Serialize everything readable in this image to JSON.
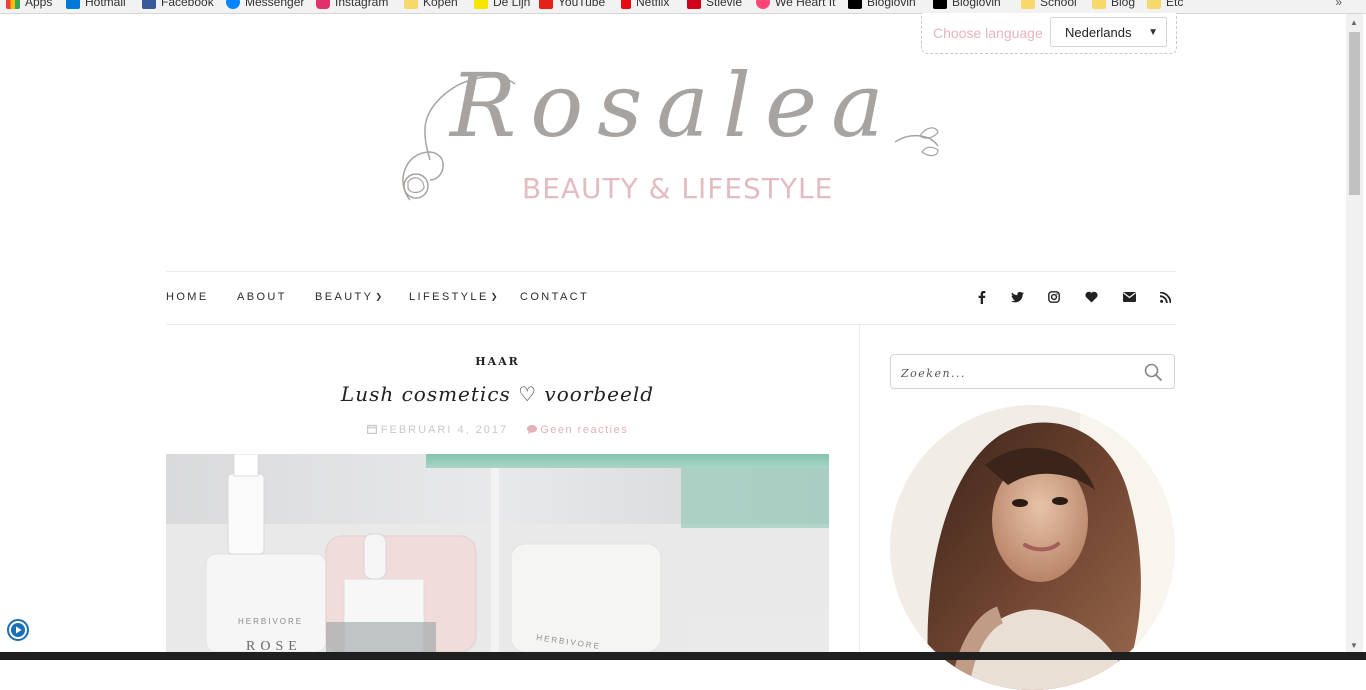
{
  "bookmarks": {
    "items": [
      {
        "label": "Apps",
        "icon": "apps-grid-icon",
        "color": "#4285f4"
      },
      {
        "label": "Hotmail",
        "icon": "hotmail-icon",
        "color": "#0078d7"
      },
      {
        "label": "Facebook",
        "icon": "facebook-icon",
        "color": "#3b5998"
      },
      {
        "label": "Messenger",
        "icon": "messenger-icon",
        "color": "#0084ff"
      },
      {
        "label": "Instagram",
        "icon": "instagram-icon",
        "color": "#e1306c"
      },
      {
        "label": "Kopen",
        "icon": "folder-icon",
        "color": "#f6d86b"
      },
      {
        "label": "De Lijn",
        "icon": "delijn-icon",
        "color": "#f7e600"
      },
      {
        "label": "YouTube",
        "icon": "youtube-icon",
        "color": "#e62117"
      },
      {
        "label": "Netflix",
        "icon": "netflix-icon",
        "color": "#e50914"
      },
      {
        "label": "Stievie",
        "icon": "stievie-icon",
        "color": "#d0021b"
      },
      {
        "label": "We Heart It",
        "icon": "weheartit-icon",
        "color": "#ff4477"
      },
      {
        "label": "Bloglovin",
        "icon": "bloglovin-icon",
        "color": "#000000"
      },
      {
        "label": "Bloglovin",
        "icon": "bloglovin-icon",
        "color": "#000000"
      },
      {
        "label": "School",
        "icon": "folder-icon",
        "color": "#f6d86b"
      },
      {
        "label": "Blog",
        "icon": "folder-icon",
        "color": "#f6d86b"
      },
      {
        "label": "Etc",
        "icon": "folder-icon",
        "color": "#f6d86b"
      }
    ],
    "more": "»"
  },
  "language": {
    "label": "Choose language",
    "selected": "Nederlands"
  },
  "logo": {
    "script": "Rosalea",
    "tagline": "BEAUTY & LIFESTYLE"
  },
  "nav": {
    "items": [
      {
        "label": "HOME",
        "dropdown": false
      },
      {
        "label": "ABOUT",
        "dropdown": false
      },
      {
        "label": "BEAUTY",
        "dropdown": true
      },
      {
        "label": "LIFESTYLE",
        "dropdown": true
      },
      {
        "label": "CONTACT",
        "dropdown": false
      }
    ],
    "social": [
      "facebook-icon",
      "twitter-icon",
      "instagram-icon",
      "heart-icon",
      "email-icon",
      "rss-icon"
    ]
  },
  "post": {
    "category": "HAAR",
    "title": "Lush cosmetics ♡ voorbeeld",
    "date": "FEBRUARI 4, 2017",
    "comments": "Geen reacties",
    "image_labels": [
      "HERBIVORE",
      "ROSE",
      "HERBIVORE"
    ]
  },
  "sidebar": {
    "search_placeholder": "Zoeken..."
  },
  "colors": {
    "accent_pink": "#e3b1ba",
    "logo_grey": "#a7a3a0",
    "text_dark": "#222222"
  }
}
